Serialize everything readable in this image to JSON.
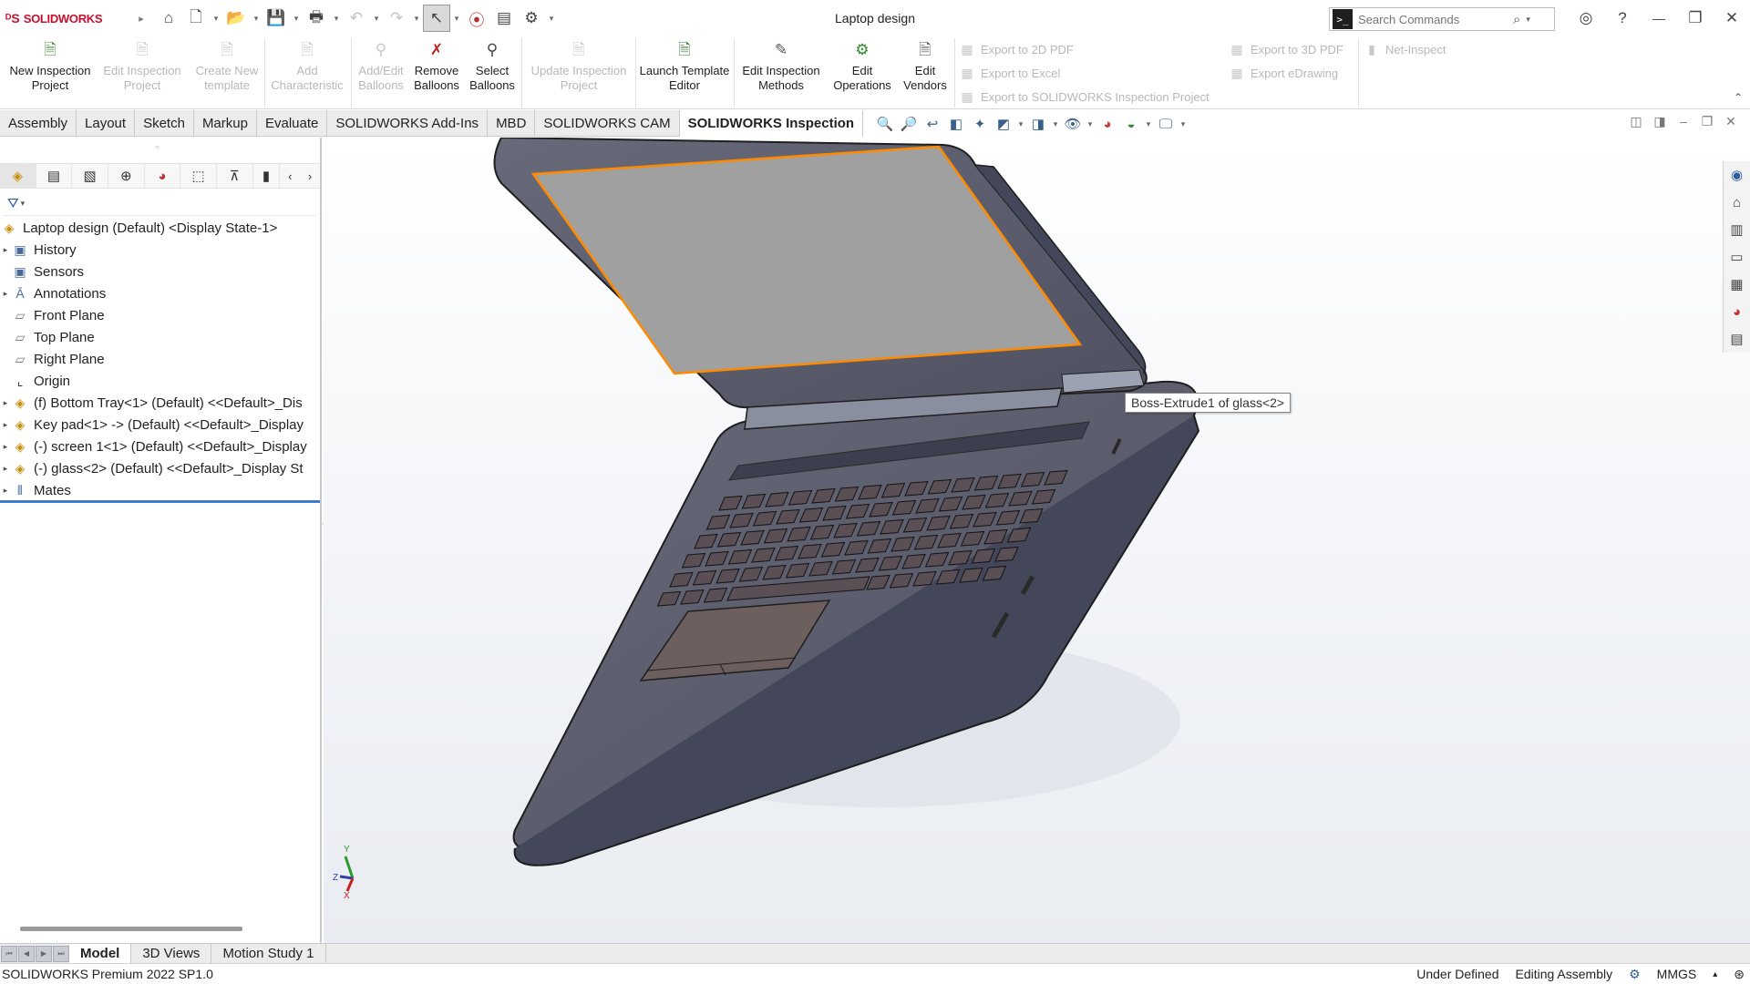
{
  "app": {
    "brand_symbol": "ᴰS",
    "brand_name": "SOLIDWORKS",
    "doc_title": "Laptop design"
  },
  "search": {
    "placeholder": "Search Commands"
  },
  "ribbon": {
    "new_inspection_project": "New Inspection Project",
    "edit_inspection_project": "Edit Inspection Project",
    "create_new_template": "Create New template",
    "add_characteristic": "Add Characteristic",
    "add_edit_balloons": "Add/Edit Balloons",
    "remove_balloons": "Remove Balloons",
    "select_balloons": "Select Balloons",
    "update_inspection_project": "Update Inspection Project",
    "launch_template_editor": "Launch Template Editor",
    "edit_inspection_methods": "Edit Inspection Methods",
    "edit_operations": "Edit Operations",
    "edit_vendors": "Edit Vendors",
    "export_2d_pdf": "Export to 2D PDF",
    "export_excel": "Export to Excel",
    "export_sw_inspection_project": "Export to SOLIDWORKS Inspection Project",
    "export_3d_pdf": "Export to 3D PDF",
    "export_edrawing": "Export eDrawing",
    "net_inspect": "Net-Inspect"
  },
  "tabs": [
    {
      "label": "Assembly"
    },
    {
      "label": "Layout"
    },
    {
      "label": "Sketch"
    },
    {
      "label": "Markup"
    },
    {
      "label": "Evaluate"
    },
    {
      "label": "SOLIDWORKS Add-Ins"
    },
    {
      "label": "MBD"
    },
    {
      "label": "SOLIDWORKS CAM"
    },
    {
      "label": "SOLIDWORKS Inspection"
    }
  ],
  "tree": {
    "root": "Laptop design (Default) <Display State-1>",
    "items": [
      {
        "label": "History",
        "icon": "history-folder-icon",
        "expandable": true
      },
      {
        "label": "Sensors",
        "icon": "sensors-icon",
        "expandable": false
      },
      {
        "label": "Annotations",
        "icon": "annotations-icon",
        "expandable": true
      },
      {
        "label": "Front Plane",
        "icon": "plane-icon",
        "expandable": false
      },
      {
        "label": "Top Plane",
        "icon": "plane-icon",
        "expandable": false
      },
      {
        "label": "Right Plane",
        "icon": "plane-icon",
        "expandable": false
      },
      {
        "label": "Origin",
        "icon": "origin-icon",
        "expandable": false
      },
      {
        "label": "(f) Bottom Tray<1> (Default) <<Default>_Dis",
        "icon": "part-icon",
        "expandable": true
      },
      {
        "label": "Key pad<1> -> (Default) <<Default>_Display",
        "icon": "part-icon",
        "expandable": true
      },
      {
        "label": "(-) screen 1<1> (Default) <<Default>_Display",
        "icon": "part-icon",
        "expandable": true
      },
      {
        "label": "(-) glass<2> (Default) <<Default>_Display St",
        "icon": "part-icon",
        "expandable": true
      },
      {
        "label": "Mates",
        "icon": "mates-icon",
        "expandable": true
      }
    ]
  },
  "viewport": {
    "tooltip": "Boss-Extrude1 of glass<2>",
    "triad": {
      "y": "Y",
      "z": "Z",
      "x": "X"
    }
  },
  "bottom_tabs": [
    {
      "label": "Model"
    },
    {
      "label": "3D Views"
    },
    {
      "label": "Motion Study 1"
    }
  ],
  "status": {
    "product": "SOLIDWORKS Premium 2022 SP1.0",
    "state": "Under Defined",
    "mode": "Editing Assembly",
    "units": "MMGS"
  },
  "colors": {
    "brand": "#c8102e",
    "laptop_body": "#5c5e6d",
    "screen_glass": "#a0a0a0",
    "selection_outline": "#ff8a00",
    "active_bar": "#3a7ad9"
  }
}
